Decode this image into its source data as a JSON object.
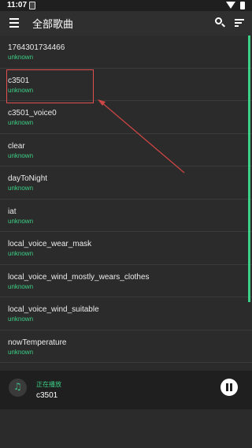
{
  "status_bar": {
    "time": "11:07"
  },
  "header": {
    "title": "全部歌曲",
    "icons": [
      "menu-icon",
      "search-icon",
      "sort-icon"
    ]
  },
  "songs": [
    {
      "title": "1764301734466",
      "artist": "unknown"
    },
    {
      "title": "c3501",
      "artist": "unknown"
    },
    {
      "title": "c3501_voice0",
      "artist": "unknown"
    },
    {
      "title": "clear",
      "artist": "unknown"
    },
    {
      "title": "dayToNight",
      "artist": "unknown"
    },
    {
      "title": "iat",
      "artist": "unknown"
    },
    {
      "title": "local_voice_wear_mask",
      "artist": "unknown"
    },
    {
      "title": "local_voice_wind_mostly_wears_clothes",
      "artist": "unknown"
    },
    {
      "title": "local_voice_wind_suitable",
      "artist": "unknown"
    },
    {
      "title": "nowTemperature",
      "artist": "unknown"
    }
  ],
  "player": {
    "status": "正在播放",
    "current_song": "c3501",
    "icon": "music-note-icon"
  },
  "colors": {
    "accent": "#3ccf86",
    "annotation": "#e05050",
    "background": "#2b2b2b"
  }
}
